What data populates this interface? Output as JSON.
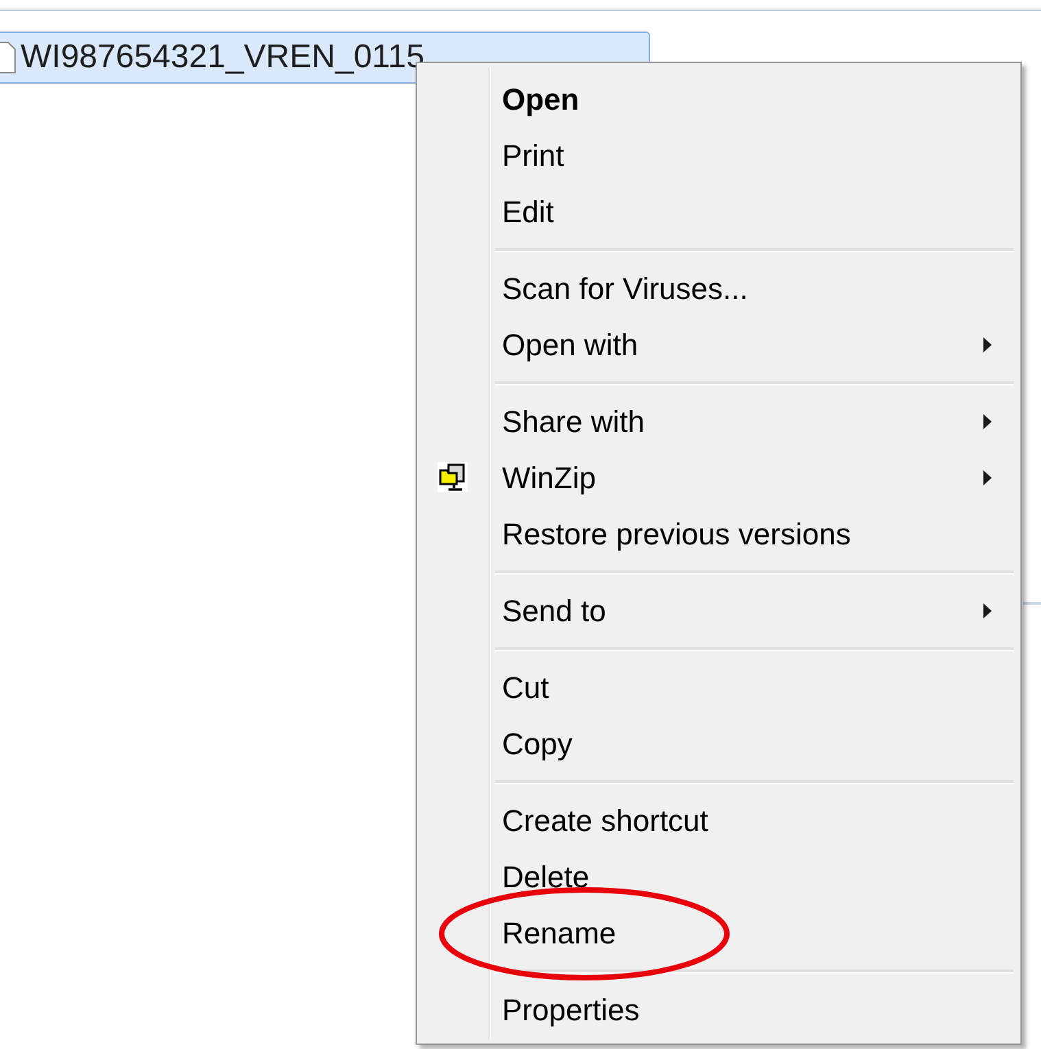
{
  "file": {
    "name": "WI987654321_VREN_0115",
    "selected": true
  },
  "context_menu": {
    "groups": [
      [
        {
          "label": "Open",
          "kind": "default",
          "has_submenu": false,
          "has_icon": false
        },
        {
          "label": "Print",
          "kind": "normal",
          "has_submenu": false,
          "has_icon": false
        },
        {
          "label": "Edit",
          "kind": "normal",
          "has_submenu": false,
          "has_icon": false
        }
      ],
      [
        {
          "label": "Scan for Viruses...",
          "kind": "normal",
          "has_submenu": false,
          "has_icon": false
        },
        {
          "label": "Open with",
          "kind": "normal",
          "has_submenu": true,
          "has_icon": false
        }
      ],
      [
        {
          "label": "Share with",
          "kind": "normal",
          "has_submenu": true,
          "has_icon": false
        },
        {
          "label": "WinZip",
          "kind": "normal",
          "has_submenu": true,
          "has_icon": true
        },
        {
          "label": "Restore previous versions",
          "kind": "normal",
          "has_submenu": false,
          "has_icon": false
        }
      ],
      [
        {
          "label": "Send to",
          "kind": "normal",
          "has_submenu": true,
          "has_icon": false
        }
      ],
      [
        {
          "label": "Cut",
          "kind": "normal",
          "has_submenu": false,
          "has_icon": false
        },
        {
          "label": "Copy",
          "kind": "normal",
          "has_submenu": false,
          "has_icon": false
        }
      ],
      [
        {
          "label": "Create shortcut",
          "kind": "normal",
          "has_submenu": false,
          "has_icon": false
        },
        {
          "label": "Delete",
          "kind": "normal",
          "has_submenu": false,
          "has_icon": false
        },
        {
          "label": "Rename",
          "kind": "normal",
          "has_submenu": false,
          "has_icon": false,
          "circled": true
        }
      ],
      [
        {
          "label": "Properties",
          "kind": "normal",
          "has_submenu": false,
          "has_icon": false
        }
      ]
    ]
  }
}
